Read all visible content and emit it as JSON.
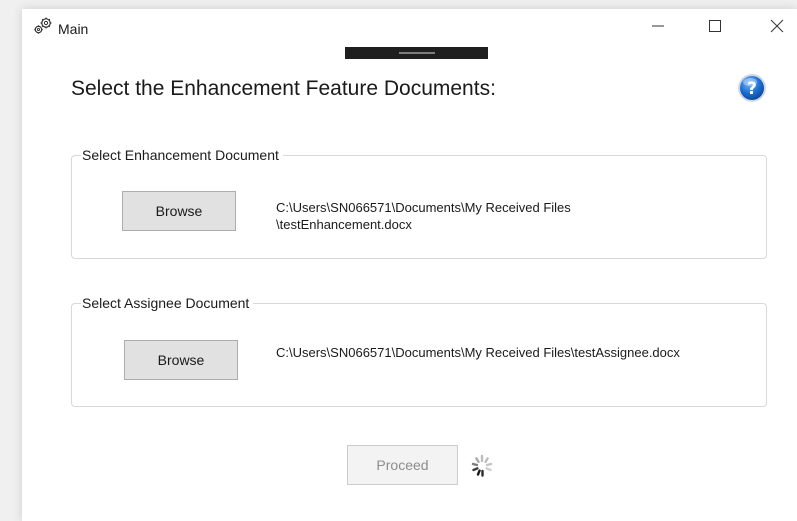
{
  "window": {
    "title": "Main",
    "app_icon": "gears-icon",
    "controls": {
      "minimize": "minimize-icon",
      "maximize": "maximize-icon",
      "close": "close-icon"
    }
  },
  "main": {
    "heading": "Select the Enhancement Feature Documents:",
    "help_icon": "help-icon",
    "enhancement": {
      "legend": "Select Enhancement Document",
      "browse_label": "Browse",
      "path_line1": "C:\\Users\\SN066571\\Documents\\My Received Files",
      "path_line2": "\\testEnhancement.docx"
    },
    "assignee": {
      "legend": "Select Assignee Document",
      "browse_label": "Browse",
      "path": "C:\\Users\\SN066571\\Documents\\My Received Files\\testAssignee.docx"
    },
    "proceed_label": "Proceed",
    "proceed_enabled": false,
    "loading_icon": "loading-spinner-icon"
  },
  "colors": {
    "window_bg": "#ffffff",
    "button_bg": "#e1e1e1",
    "button_border": "#adadad",
    "disabled_text": "#8c8c8c",
    "help_blue": "#1c6fd1"
  }
}
